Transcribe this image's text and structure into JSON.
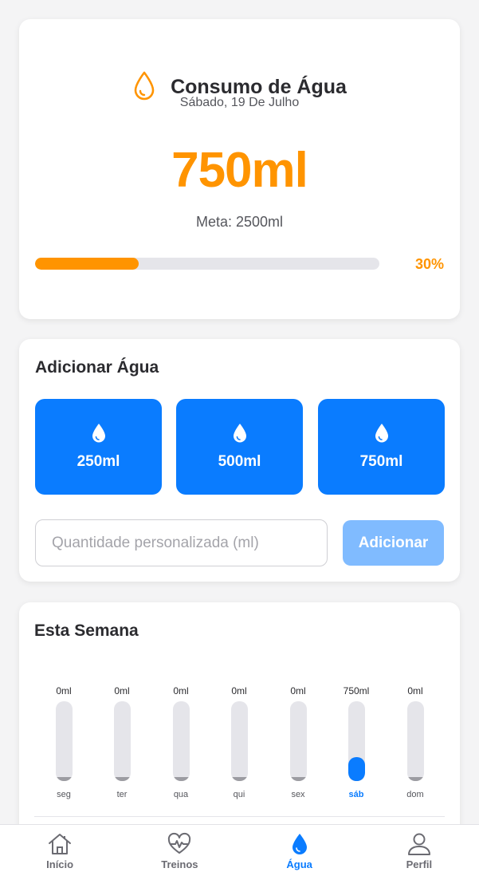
{
  "summary": {
    "title": "Consumo de Água",
    "date": "Sábado, 19 De Julho",
    "amount": "750ml",
    "goal": "Meta: 2500ml",
    "progress_percent": 30,
    "progress_label": "30%",
    "accent_color": "#ff9400"
  },
  "add_water": {
    "title": "Adicionar Água",
    "quick_options": [
      {
        "label": "250ml",
        "icon": "water-drop-icon"
      },
      {
        "label": "500ml",
        "icon": "water-drop-icon"
      },
      {
        "label": "750ml",
        "icon": "water-drop-icon"
      }
    ],
    "custom_placeholder": "Quantidade personalizada (ml)",
    "custom_value": "",
    "add_button_label": "Adicionar",
    "primary_color": "#0a7cff"
  },
  "week": {
    "title": "Esta Semana",
    "days": [
      {
        "label": "seg",
        "value_label": "0ml",
        "value_ml": 0
      },
      {
        "label": "ter",
        "value_label": "0ml",
        "value_ml": 0
      },
      {
        "label": "qua",
        "value_label": "0ml",
        "value_ml": 0
      },
      {
        "label": "qui",
        "value_label": "0ml",
        "value_ml": 0
      },
      {
        "label": "sex",
        "value_label": "0ml",
        "value_ml": 0
      },
      {
        "label": "sáb",
        "value_label": "750ml",
        "value_ml": 750,
        "active": true
      },
      {
        "label": "dom",
        "value_label": "0ml",
        "value_ml": 0
      }
    ]
  },
  "nav": {
    "items": [
      {
        "label": "Início",
        "icon": "home-icon"
      },
      {
        "label": "Treinos",
        "icon": "heart-pulse-icon"
      },
      {
        "label": "Água",
        "icon": "water-drop-icon",
        "active": true
      },
      {
        "label": "Perfil",
        "icon": "user-icon"
      }
    ]
  }
}
